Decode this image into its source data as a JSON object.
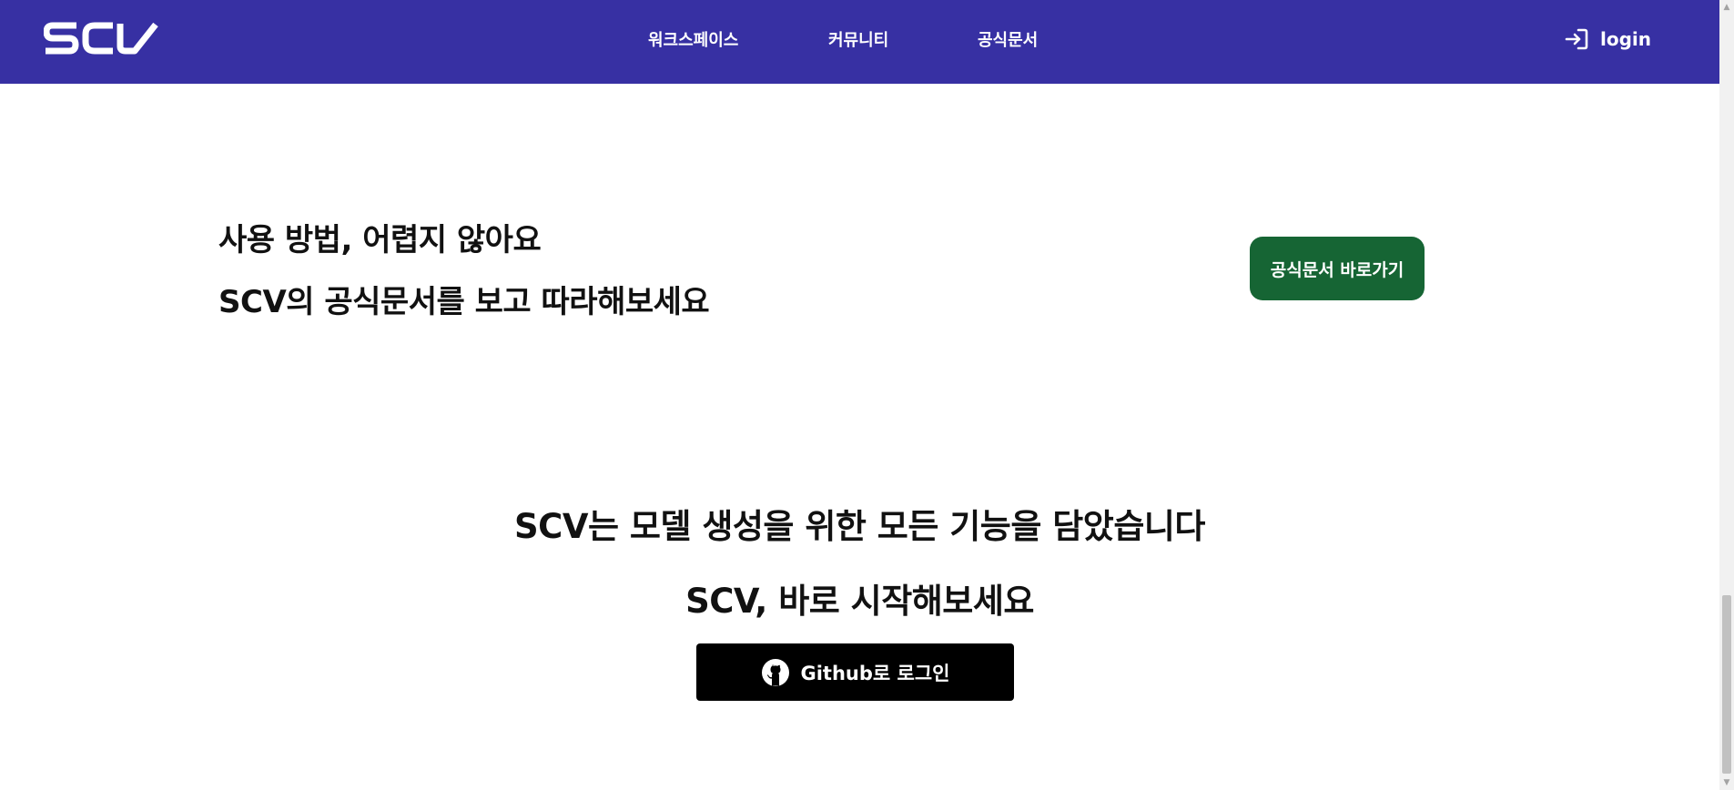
{
  "header": {
    "logo_text": "SCV",
    "nav": [
      {
        "label": "워크스페이스"
      },
      {
        "label": "커뮤니티"
      },
      {
        "label": "공식문서"
      }
    ],
    "login_label": "login",
    "login_icon": "login-icon"
  },
  "docs_section": {
    "line1": "사용 방법, 어렵지 않아요",
    "line2": "SCV의 공식문서를 보고 따라해보세요",
    "button_label": "공식문서 바로가기"
  },
  "start_section": {
    "line1": "SCV는 모델 생성을 위한 모든 기능을 담았습니다",
    "line2": "SCV, 바로 시작해보세요",
    "github_button_label": "Github로 로그인",
    "github_icon": "github-icon"
  },
  "colors": {
    "header_bg": "#3730a3",
    "docs_button_bg": "#166534",
    "github_button_bg": "#000000"
  }
}
